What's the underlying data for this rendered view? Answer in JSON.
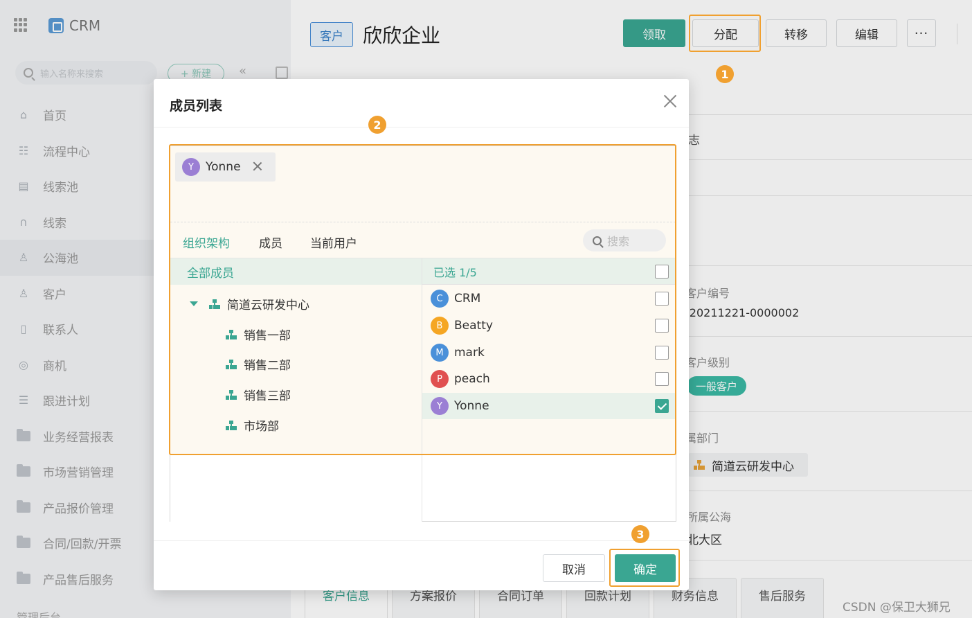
{
  "sidebar": {
    "app_title": "CRM",
    "search_placeholder": "输入名称来搜索",
    "new_label": "+ 新建",
    "collapse_symbol": "«",
    "items": [
      {
        "label": "首页",
        "icon": "home-icon"
      },
      {
        "label": "流程中心",
        "icon": "flow-icon"
      },
      {
        "label": "线索池",
        "icon": "lead-pool-icon"
      },
      {
        "label": "线索",
        "icon": "lead-icon"
      },
      {
        "label": "公海池",
        "icon": "sea-pool-icon",
        "active": true
      },
      {
        "label": "客户",
        "icon": "customer-icon"
      },
      {
        "label": "联系人",
        "icon": "contact-icon"
      },
      {
        "label": "商机",
        "icon": "opportunity-icon"
      },
      {
        "label": "跟进计划",
        "icon": "plan-icon"
      },
      {
        "label": "业务经营报表",
        "icon": "folder-icon"
      },
      {
        "label": "市场营销管理",
        "icon": "folder-icon"
      },
      {
        "label": "产品报价管理",
        "icon": "folder-icon"
      },
      {
        "label": "合同/回款/开票",
        "icon": "folder-icon"
      },
      {
        "label": "产品售后服务",
        "icon": "folder-icon"
      }
    ],
    "bottom_label": "管理后台"
  },
  "header": {
    "tag": "客户",
    "customer_name": "欣欣企业",
    "buttons": {
      "claim": "领取",
      "assign": "分配",
      "transfer": "转移",
      "edit": "编辑",
      "more": "···"
    }
  },
  "annotations": {
    "step1": "1",
    "step2": "2",
    "step3": "3",
    "color": "#f0a030"
  },
  "right_panel": {
    "log_tab": "志",
    "fields": [
      {
        "label": "客户编号",
        "value": "-20211221-0000002"
      },
      {
        "label": "客户级别",
        "value": "一般客户"
      },
      {
        "label": "属部门",
        "value": "简道云研发中心"
      },
      {
        "label": "所属公海",
        "value": "北大区"
      }
    ]
  },
  "bottom_tabs": [
    "客户信息",
    "方案报价",
    "合同订单",
    "回款计划",
    "财务信息",
    "售后服务"
  ],
  "dialog": {
    "title": "成员列表",
    "selected_chip": {
      "initial": "Y",
      "name": "Yonne"
    },
    "tabs": [
      "组织架构",
      "成员",
      "当前用户"
    ],
    "search_placeholder": "搜索",
    "all_members_label": "全部成员",
    "tree": [
      {
        "label": "简道云研发中心",
        "level": 0,
        "expanded": true
      },
      {
        "label": "销售一部",
        "level": 1
      },
      {
        "label": "销售二部",
        "level": 1
      },
      {
        "label": "销售三部",
        "level": 1
      },
      {
        "label": "市场部",
        "level": 1
      }
    ],
    "selected_count": "已选 1/5",
    "members": [
      {
        "initial": "C",
        "name": "CRM",
        "color": "#4a90d9",
        "checked": false
      },
      {
        "initial": "B",
        "name": "Beatty",
        "color": "#f5a623",
        "checked": false
      },
      {
        "initial": "M",
        "name": "mark",
        "color": "#4a90d9",
        "checked": false
      },
      {
        "initial": "P",
        "name": "peach",
        "color": "#e05050",
        "checked": false
      },
      {
        "initial": "Y",
        "name": "Yonne",
        "color": "#9b7fd4",
        "checked": true
      }
    ],
    "cancel_label": "取消",
    "ok_label": "确定"
  },
  "watermark": "CSDN @保卫大狮兄",
  "colors": {
    "accent": "#3aa692",
    "highlight": "#f0a030",
    "tag_blue": "#3b82c9"
  }
}
